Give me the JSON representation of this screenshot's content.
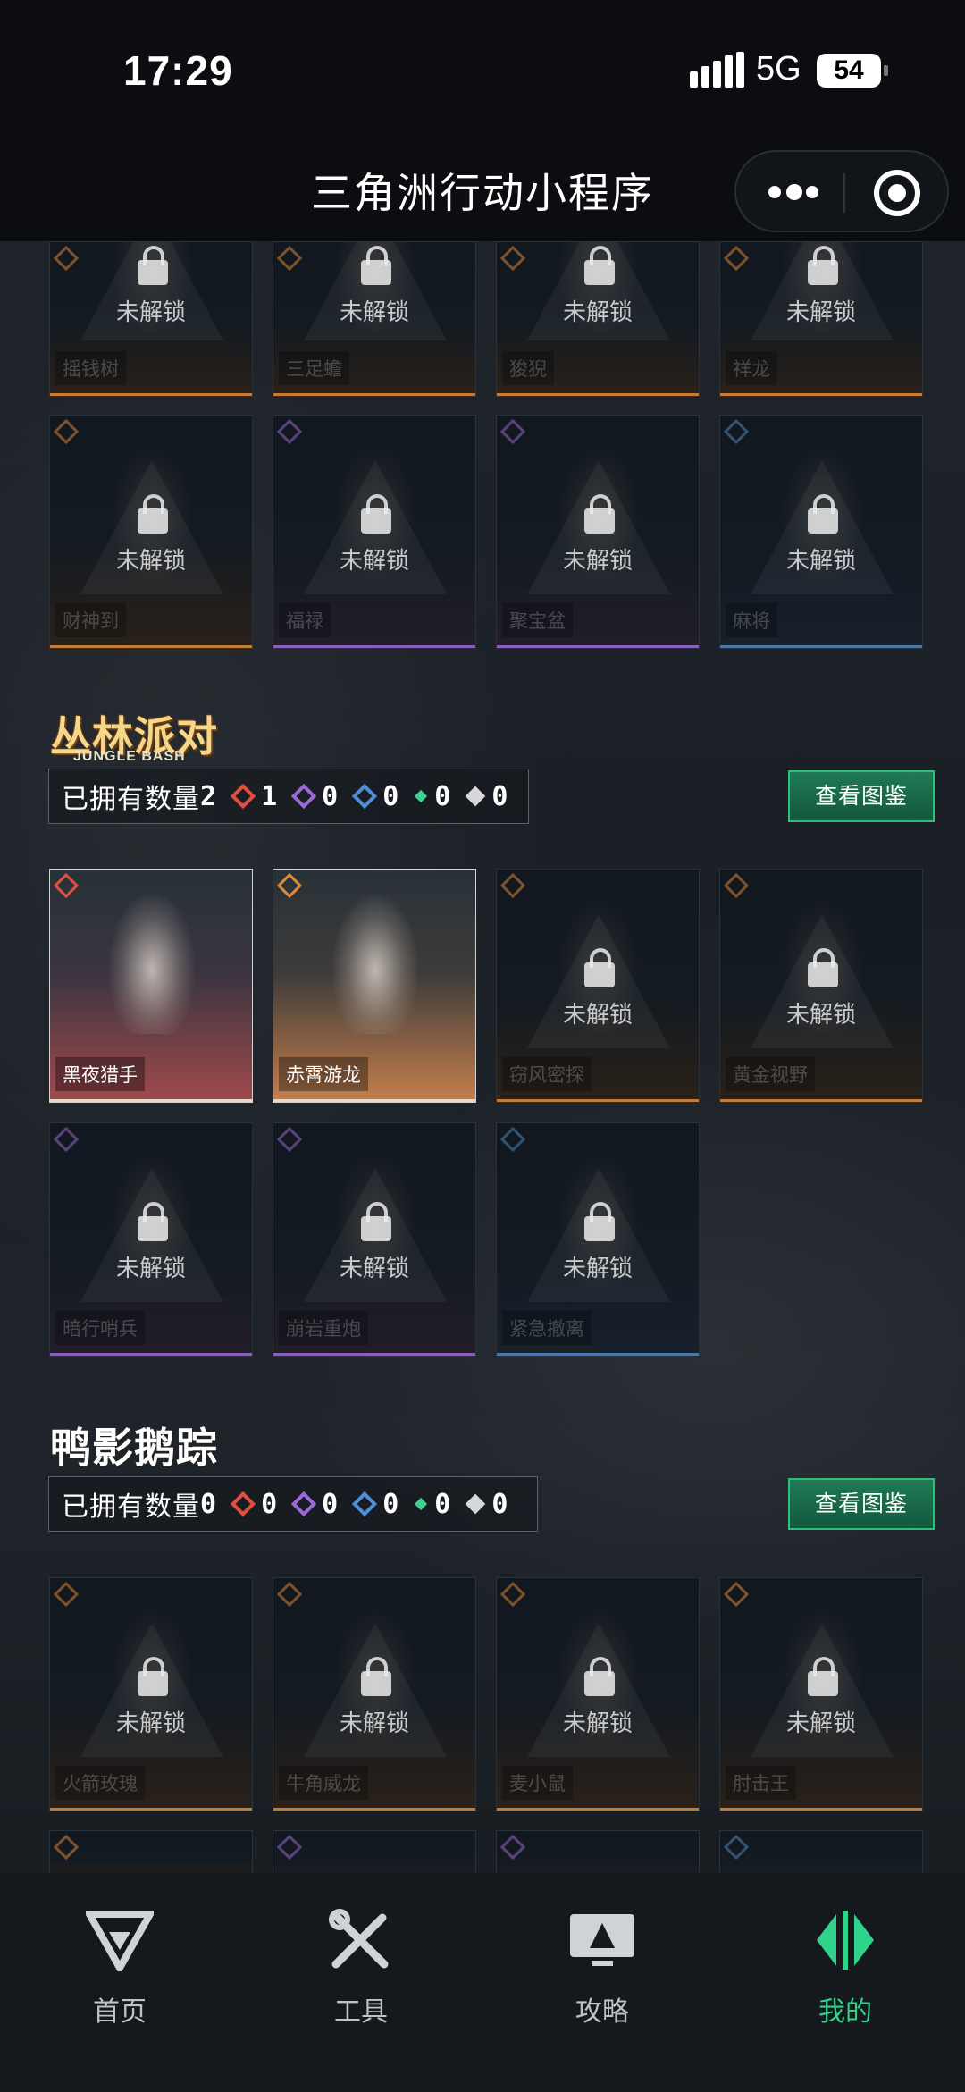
{
  "status": {
    "time": "17:29",
    "network": "5G",
    "battery": "54"
  },
  "header": {
    "title": "三角洲行动小程序"
  },
  "lock_text": "未解锁",
  "section0": {
    "row1": [
      {
        "name": "摇钱树",
        "rarity": "orange"
      },
      {
        "name": "三足蟾",
        "rarity": "orange"
      },
      {
        "name": "狻猊",
        "rarity": "orange"
      },
      {
        "name": "祥龙",
        "rarity": "orange"
      }
    ],
    "row2": [
      {
        "name": "财神到",
        "rarity": "orange"
      },
      {
        "name": "福禄",
        "rarity": "purple"
      },
      {
        "name": "聚宝盆",
        "rarity": "purple"
      },
      {
        "name": "麻将",
        "rarity": "blue"
      }
    ]
  },
  "jungle": {
    "logo": "丛林派对",
    "logo_sub": "JUNGLE BASH",
    "owned_label": "已拥有数量",
    "owned_count": "2",
    "counts": [
      "1",
      "0",
      "0",
      "0",
      "0"
    ],
    "button": "查看图鉴",
    "items": [
      {
        "name": "黑夜猎手",
        "owned": true,
        "rarity": "red"
      },
      {
        "name": "赤霄游龙",
        "owned": true,
        "rarity": "orange"
      },
      {
        "name": "窃风密探",
        "owned": false,
        "rarity": "orange"
      },
      {
        "name": "黄金视野",
        "owned": false,
        "rarity": "orange"
      },
      {
        "name": "暗行哨兵",
        "owned": false,
        "rarity": "purple"
      },
      {
        "name": "崩岩重炮",
        "owned": false,
        "rarity": "purple"
      },
      {
        "name": "紧急撤离",
        "owned": false,
        "rarity": "blue"
      }
    ]
  },
  "duck": {
    "logo": "鸭影鹅踪",
    "owned_label": "已拥有数量",
    "owned_count": "0",
    "counts": [
      "0",
      "0",
      "0",
      "0",
      "0"
    ],
    "button": "查看图鉴",
    "items": [
      {
        "name": "火箭玫瑰",
        "rarity": "orange"
      },
      {
        "name": "牛角威龙",
        "rarity": "orange"
      },
      {
        "name": "麦小鼠",
        "rarity": "orange"
      },
      {
        "name": "肘击王",
        "rarity": "orange"
      }
    ]
  },
  "rarity_colors": {
    "red": "#e0503e",
    "orange": "#e08b3c",
    "purple": "#9b6ad6",
    "blue": "#4f8fd8",
    "green": "#3fcf8e",
    "white": "#d8d8d8"
  },
  "tabs": [
    {
      "label": "首页",
      "icon": "home-icon"
    },
    {
      "label": "工具",
      "icon": "tools-icon"
    },
    {
      "label": "攻略",
      "icon": "guide-icon"
    },
    {
      "label": "我的",
      "icon": "profile-icon"
    }
  ]
}
